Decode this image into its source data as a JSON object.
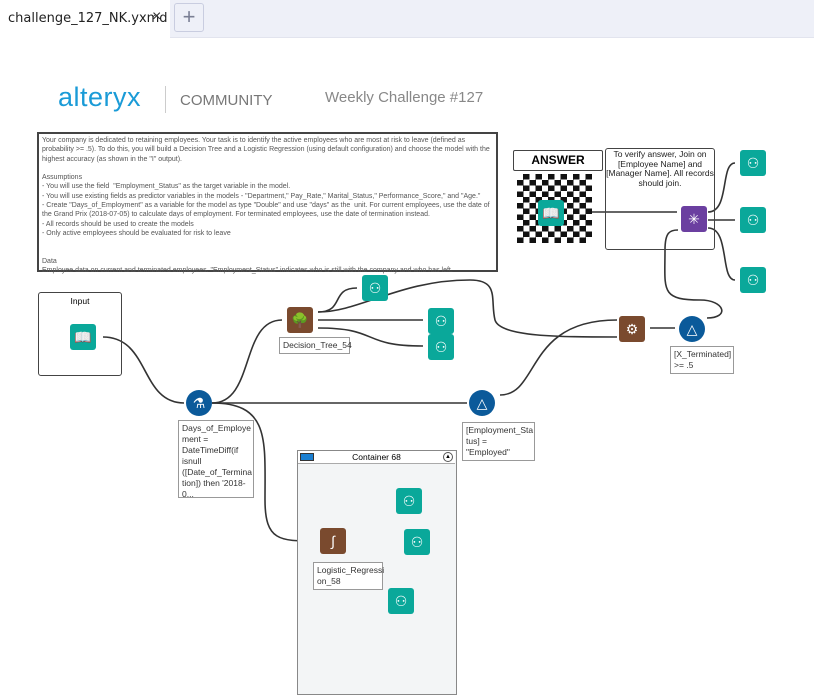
{
  "tab": {
    "title": "challenge_127_NK.yxmd",
    "close": "×",
    "add": "+"
  },
  "header": {
    "logo": "alteryx",
    "community": "COMMUNITY",
    "title": "Weekly Challenge #127"
  },
  "description": "Your company is dedicated to retaining employees. Your task is to identify the active employees who are most at risk to leave (defined as probability >= .5). To do this, you will build a Decision Tree and a Logistic Regression (using default configuration) and choose the model with the highest accuracy (as shown in the \"I\" output).\n\nAssumptions\n- You will use the field  \"Employment_Status\" as the target variable in the model.\n- You will use existing fields as predictor variables in the models - \"Department,\" Pay_Rate,\" Marital_Status,\" Performance_Score,\" and \"Age.\"\n- Create \"Days_of_Employment\" as a variable for the model as type \"Double\" and use \"days\" as the  unit. For current employees, use the date of the Grand Prix (2018-07-05) to calculate days of employment. For terminated employees, use the date of termination instead.\n- All records should be used to create the models\n- Only active employees should be evaluated for risk to leave\n\n\nData\nEmployee data on current and terminated employees. \"Employment_Status\" indicates who is still with the company and who has left.",
  "answer": {
    "label": "ANSWER"
  },
  "join_note": "To verify answer, Join on [Employee Name] and [Manager Name]. All records should join.",
  "input_box": {
    "label": "Input"
  },
  "formula": {
    "label": "Days_of_Employe ment = DateTimeDiff(if isnull ([Date_of_Termina tion]) then '2018-0..."
  },
  "decision_tree": {
    "label": "Decision_Tree_54"
  },
  "filter_employed": {
    "label": "[Employment_Sta tus] = \"Employed\""
  },
  "filter_terminated": {
    "label": "[X_Terminated] >= .5"
  },
  "container": {
    "label": "Container 68"
  },
  "logistic": {
    "label": "Logistic_Regressi on_58"
  },
  "colors": {
    "browse": "#0aa89a",
    "model": "#7a4a2e",
    "join": "#6b3fa0",
    "filter": "#0b5a9a",
    "brand": "#1a9bd7"
  }
}
